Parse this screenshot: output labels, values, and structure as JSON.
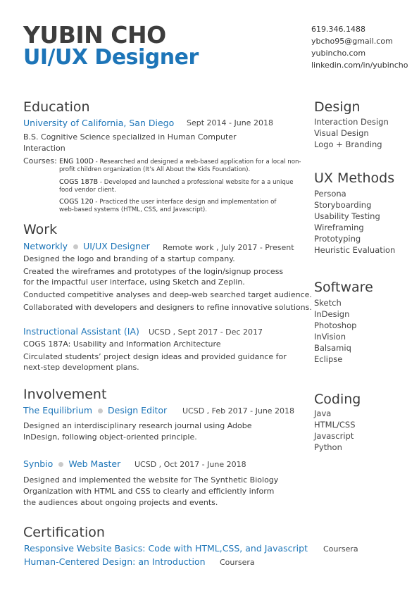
{
  "header": {
    "name": "YUBIN CHO",
    "title": "UI/UX Designer",
    "phone": "619.346.1488",
    "email": "ybcho95@gmail.com",
    "website": "yubincho.com",
    "linkedin": "linkedin.com/in/yubincho"
  },
  "education": {
    "heading": "Education",
    "school": "University of California, San Diego",
    "dates": "Sept 2014 - June 2018",
    "degree": "B.S. Cognitive Science specialized in Human Computer Interaction",
    "courses_label": "Courses:",
    "courses": [
      {
        "code": "ENG 100D",
        "desc": " - Researched and designed a web-based application for a local non-profit children organization (It’s All About the Kids Foundation)."
      },
      {
        "code": "COGS 187B",
        "desc": " - Developed and launched a professional website for a a unique food vendor client."
      },
      {
        "code": "COGS 120",
        "desc": " - Practiced the user interface design and implementation of web-based systems (HTML, CSS, and Javascript)."
      }
    ]
  },
  "work": {
    "heading": "Work",
    "jobs": [
      {
        "org": "Networkly",
        "role": "UI/UX Designer",
        "meta": "Remote work ,  July 2017 - Present",
        "bullets": [
          "Designed the logo and branding of a startup company.",
          "Created the wireframes and prototypes of the login/signup process for the impactful user interface, using Sketch and Zeplin.",
          "Conducted competitive analyses and deep-web searched target audience.",
          "Collaborated with developers and designers to refine innovative solutions."
        ]
      },
      {
        "role": "Instructional Assistant (IA)",
        "meta": "UCSD ,  Sept 2017 - Dec 2017",
        "course": "COGS 187A: Usability and Information Architecture",
        "desc": "Circulated students’ project design ideas and provided guidance for next-step development plans."
      }
    ]
  },
  "involvement": {
    "heading": "Involvement",
    "items": [
      {
        "org": "The Equilibrium",
        "role": "Design Editor",
        "meta": "UCSD ,  Feb 2017 - June 2018",
        "desc": "Designed an interdisciplinary research journal using Adobe InDesign, following object-oriented principle."
      },
      {
        "org": "Synbio",
        "role": "Web Master",
        "meta": "UCSD ,  Oct 2017 - June 2018",
        "desc": "Designed and implemented the website for The Synthetic Biology Organization with HTML and CSS to clearly and efficiently inform the audiences about ongoing projects and events."
      }
    ]
  },
  "certification": {
    "heading": "Certification",
    "items": [
      {
        "name": "Responsive Website Basics: Code with HTML,CSS, and Javascript",
        "provider": "Coursera"
      },
      {
        "name": "Human-Centered Design: an Introduction",
        "provider": "Coursera"
      }
    ]
  },
  "sidebar": {
    "design": {
      "heading": "Design",
      "items": [
        "Interaction Design",
        "Visual Design",
        "Logo + Branding"
      ]
    },
    "ux_methods": {
      "heading": "UX Methods",
      "items": [
        "Persona",
        "Storyboarding",
        "Usability Testing",
        "Wireframing",
        "Prototyping",
        "Heuristic Evaluation"
      ]
    },
    "software": {
      "heading": "Software",
      "items": [
        "Sketch",
        "InDesign",
        "Photoshop",
        "InVision",
        "Balsamiq",
        "Eclipse"
      ]
    },
    "coding": {
      "heading": "Coding",
      "items": [
        "Java",
        "HTML/CSS",
        "Javascript",
        "Python"
      ]
    }
  },
  "colors": {
    "accent": "#1d75b8",
    "text": "#3a3a3a",
    "dot": "#c9c9c9"
  }
}
